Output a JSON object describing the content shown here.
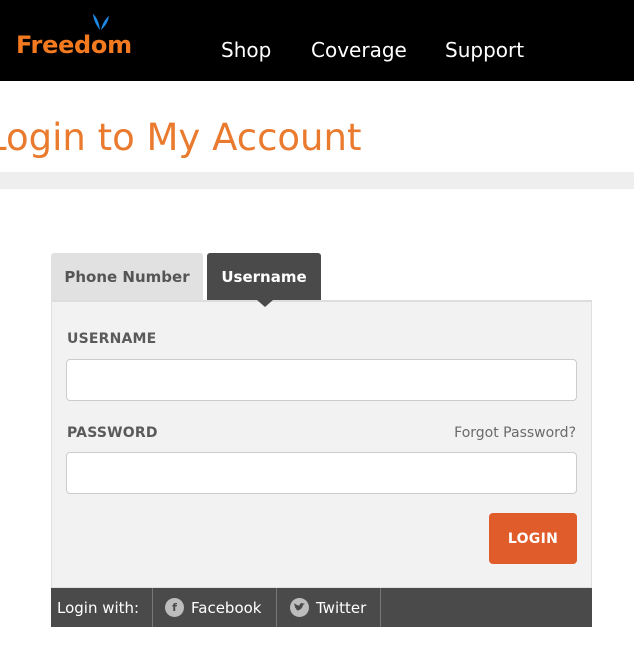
{
  "header": {
    "logo_text": "Freedom",
    "nav": [
      "Shop",
      "Coverage",
      "Support"
    ]
  },
  "page": {
    "title": "Login to My Account"
  },
  "tabs": [
    {
      "label": "Phone Number",
      "active": false
    },
    {
      "label": "Username",
      "active": true
    }
  ],
  "form": {
    "username_label": "USERNAME",
    "username_value": "",
    "password_label": "PASSWORD",
    "password_value": "",
    "forgot_label": "Forgot Password?",
    "login_label": "LOGIN"
  },
  "social": {
    "label": "Login with:",
    "facebook": "Facebook",
    "twitter": "Twitter",
    "facebook_icon": "facebook-icon",
    "twitter_icon": "twitter-icon"
  },
  "colors": {
    "brand_orange": "#f47a20",
    "title_orange": "#e97a2e",
    "login_button": "#e15c2b",
    "dark_gray": "#4a4a4a"
  }
}
